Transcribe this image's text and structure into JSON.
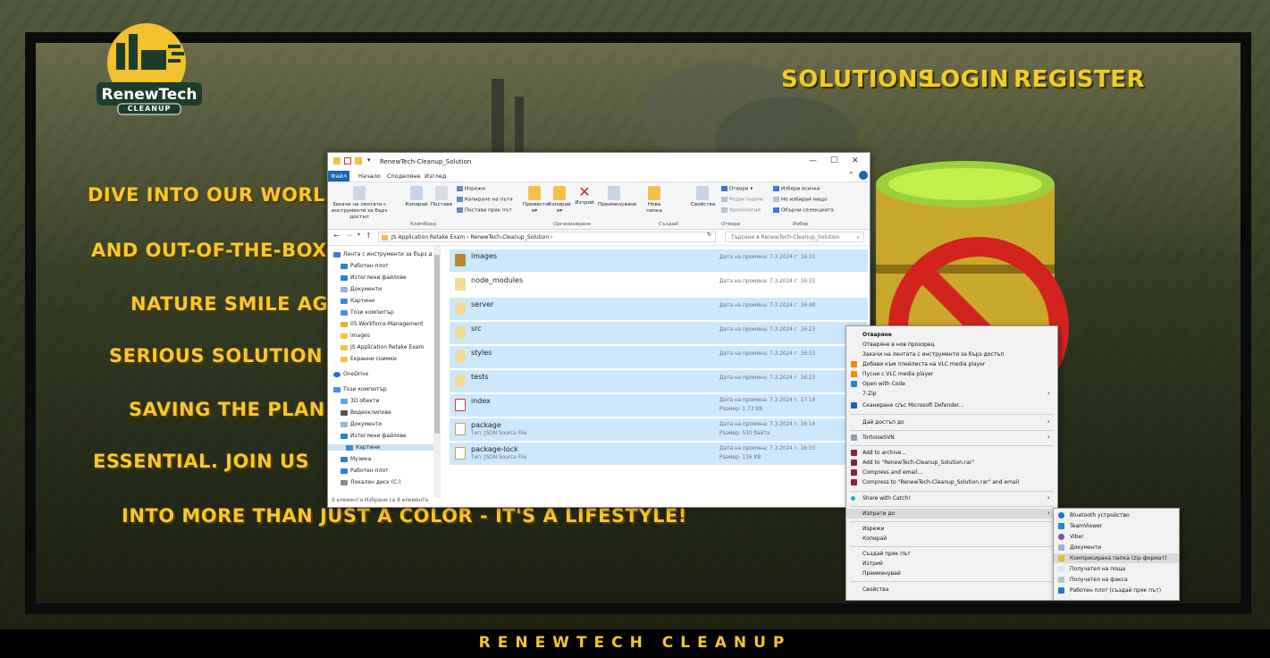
{
  "site": {
    "logo_main": "RenewTech",
    "logo_sub": "CLEANUP",
    "nav": [
      "SOLUTIONS",
      "LOGIN",
      "REGISTER"
    ],
    "hero_lines": [
      "DIVE INTO OUR WORL",
      "AND OUT-OF-THE-BOX",
      "NATURE SMILE AG",
      "SERIOUS SOLUTION",
      "SAVING THE PLAN",
      "ESSENTIAL. JOIN US",
      "INTO MORE THAN JUST A COLOR - IT'S A LIFESTYLE!"
    ],
    "footer": "RENEWTECH CLEANUP",
    "colors": {
      "accent": "#f6c82a",
      "frame": "#0b0b0b"
    }
  },
  "explorer": {
    "title": "RenewTech-Cleanup_Solution",
    "tabs": [
      "Файл",
      "Начало",
      "Споделяне",
      "Изглед"
    ],
    "ribbon": {
      "pin": "Закачи на лентата с инструменти за бърз достъп",
      "copy": "Копирай",
      "paste": "Постави",
      "cut": "Изрежи",
      "copy_path": "Копиране на пътя",
      "paste_shortcut": "Постави пряк път",
      "clipboard_group": "Клипборд",
      "move_to": "Премести в▾",
      "copy_to": "Копирай в▾",
      "delete": "Изтрий",
      "rename": "Преименуване",
      "organize_group": "Организиране",
      "new_folder": "Нова папка",
      "new_group": "Създай",
      "properties": "Свойства",
      "open": "Отвори ▾",
      "edit": "Редактиране",
      "history": "Хронология",
      "open_group": "Отвори",
      "select_all": "Избери всички",
      "select_none": "Не избирай нищо",
      "invert": "Обърни селекцията",
      "select_group": "Избор"
    },
    "address": "JS Application Retake Exam  ›  RenewTech-Cleanup_Solution  ›",
    "search_placeholder": "Търсене в RenewTech-Cleanup_Solution",
    "nav_pane": [
      "Лента с инструменти за бърз д",
      "Работен плот",
      "Изтеглени файлове",
      "Документи",
      "Картини",
      "Този компютър",
      "05.Workforce-Management",
      "images",
      "JS Application Retake Exam",
      "Екранни снимки",
      "OneDrive",
      "Този компютър",
      "3D обекти",
      "Видеоклипове",
      "Документи",
      "Изтеглени файлове",
      "Картини",
      "Музика",
      "Работен плот",
      "Локален диск (C:)"
    ],
    "files": [
      {
        "name": "images",
        "sub": "",
        "date": "Дата на промяна: 7.3.2024 г. 16:33",
        "size": ""
      },
      {
        "name": "node_modules",
        "sub": "",
        "date": "Дата на промяна: 7.3.2024 г. 16:33",
        "size": ""
      },
      {
        "name": "server",
        "sub": "",
        "date": "Дата на промяна: 7.3.2024 г. 16:48",
        "size": ""
      },
      {
        "name": "src",
        "sub": "",
        "date": "Дата на промяна: 7.3.2024 г. 16:23",
        "size": ""
      },
      {
        "name": "styles",
        "sub": "",
        "date": "Дата на промяна: 7.3.2024 г. 16:33",
        "size": ""
      },
      {
        "name": "tests",
        "sub": "",
        "date": "Дата на промяна: 7.3.2024 г. 16:23",
        "size": ""
      },
      {
        "name": "index",
        "sub": "",
        "date": "Дата на промяна: 7.3.2024 г. 17:14",
        "size": "Размер: 1,73 KB"
      },
      {
        "name": "package",
        "sub": "Тип: JSON Source File",
        "date": "Дата на промяна: 7.3.2024 г. 16:14",
        "size": "Размер: 510 байта"
      },
      {
        "name": "package-lock",
        "sub": "Тип: JSON Source File",
        "date": "Дата на промяна: 7.3.2024 г. 16:33",
        "size": "Размер: 116 KB"
      }
    ],
    "status": "9 елемента    Избрани са 8 елемента"
  },
  "context_menu": {
    "items": [
      "Отваряне",
      "Отваряне в нов прозорец",
      "Закачи на лентата с инструменти за бърз достъп",
      "Добави към плейлиста на VLC media player",
      "Пусни с VLC media player",
      "Open with Code",
      "7-Zip",
      "Сканиране с/ъс Microsoft Defender...",
      "Дай достъп до",
      "TortoiseSVN",
      "Add to archive...",
      "Add to \"RenewTech-Cleanup_Solution.rar\"",
      "Compress and email...",
      "Compress to \"RenewTech-Cleanup_Solution.rar\" and email",
      "Share with Catch!",
      "Изпрати до",
      "Изрежи",
      "Копирай",
      "Създай пряк път",
      "Изтрий",
      "Преименувай",
      "Свойства"
    ]
  },
  "send_to_menu": {
    "items": [
      "Bluetooth устройство",
      "TeamViewer",
      "Viber",
      "Документи",
      "Компресирана папка (zip формат)",
      "Получател на поща",
      "Получател на факса",
      "Работен плот (създай пряк път)"
    ]
  }
}
